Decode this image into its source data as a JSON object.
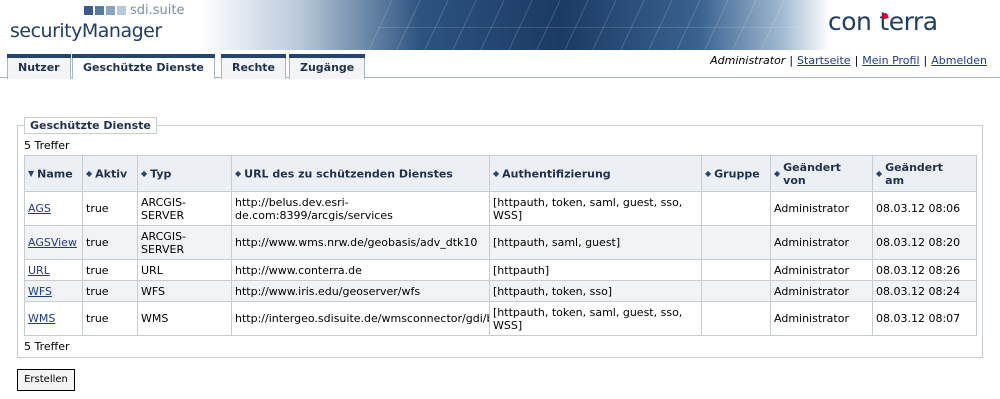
{
  "header": {
    "suite": "sdi.suite",
    "product": "securityManager",
    "brand_left": "con",
    "brand_right": "terra",
    "logo_square_colors": [
      "#3b5a8a",
      "#5a7aa6",
      "#8ba2c2",
      "#b9c7da"
    ]
  },
  "tabs": [
    {
      "label": "Nutzer",
      "active": false
    },
    {
      "label": "Geschützte Dienste",
      "active": true
    },
    {
      "label": "Rechte",
      "active": false
    },
    {
      "label": "Zugänge",
      "active": false
    }
  ],
  "userbar": {
    "user": "Administrator",
    "links": [
      "Startseite",
      "Mein Profil",
      "Abmelden"
    ]
  },
  "panel": {
    "title": "Geschützte Dienste",
    "hits_top": "5 Treffer",
    "hits_bottom": "5 Treffer"
  },
  "table": {
    "columns": [
      {
        "label": "Name",
        "sort": "▼"
      },
      {
        "label": "Aktiv",
        "sort": "◆"
      },
      {
        "label": "Typ",
        "sort": "◆"
      },
      {
        "label": "URL des zu schützenden Dienstes",
        "sort": "◆"
      },
      {
        "label": "Authentifizierung",
        "sort": "◆"
      },
      {
        "label": "Gruppe",
        "sort": "◆"
      },
      {
        "label": "Geändert von",
        "sort": "◆"
      },
      {
        "label": "Geändert am",
        "sort": "◆"
      }
    ],
    "rows": [
      [
        "AGS",
        "true",
        "ARCGIS-SERVER",
        "http://belus.dev.esri-de.com:8399/arcgis/services",
        "[httpauth, token, saml, guest, sso, WSS]",
        "",
        "Administrator",
        "08.03.12 08:06"
      ],
      [
        "AGSView",
        "true",
        "ARCGIS-SERVER",
        "http://www.wms.nrw.de/geobasis/adv_dtk10",
        "[httpauth, saml, guest]",
        "",
        "Administrator",
        "08.03.12 08:20"
      ],
      [
        "URL",
        "true",
        "URL",
        "http://www.conterra.de",
        "[httpauth]",
        "",
        "Administrator",
        "08.03.12 08:26"
      ],
      [
        "WFS",
        "true",
        "WFS",
        "http://www.iris.edu/geoserver/wfs",
        "[httpauth, token, sso]",
        "",
        "Administrator",
        "08.03.12 08:24"
      ],
      [
        "WMS",
        "true",
        "WMS",
        "http://intergeo.sdisuite.de/wmsconnector/gdi/brd",
        "[httpauth, token, saml, guest, sso, WSS]",
        "",
        "Administrator",
        "08.03.12 08:07"
      ]
    ]
  },
  "buttons": {
    "create": "Erstellen"
  }
}
